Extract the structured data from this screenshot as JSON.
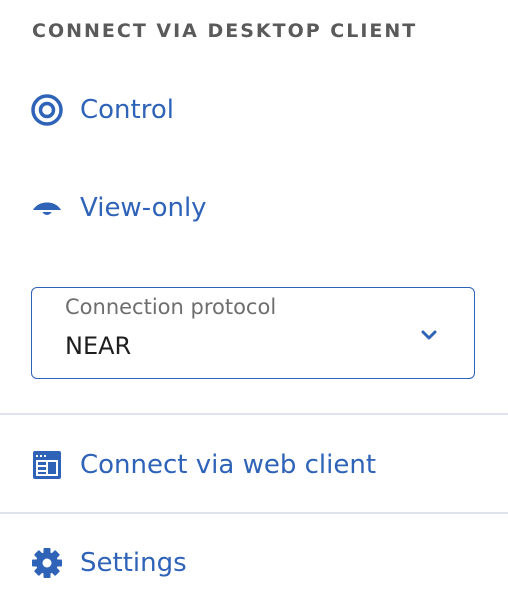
{
  "section": {
    "title": "CONNECT VIA DESKTOP CLIENT"
  },
  "menu": {
    "control": {
      "label": "Control",
      "icon": "target-icon"
    },
    "view_only": {
      "label": "View-only",
      "icon": "eye-icon"
    },
    "web_client": {
      "label": "Connect via web client",
      "icon": "browser-window-icon"
    },
    "settings": {
      "label": "Settings",
      "icon": "gear-icon"
    }
  },
  "protocol_select": {
    "label": "Connection protocol",
    "value": "NEAR"
  },
  "colors": {
    "accent": "#2f63b8",
    "title_gray": "#5a5a5a",
    "divider": "#dfe5ee"
  }
}
